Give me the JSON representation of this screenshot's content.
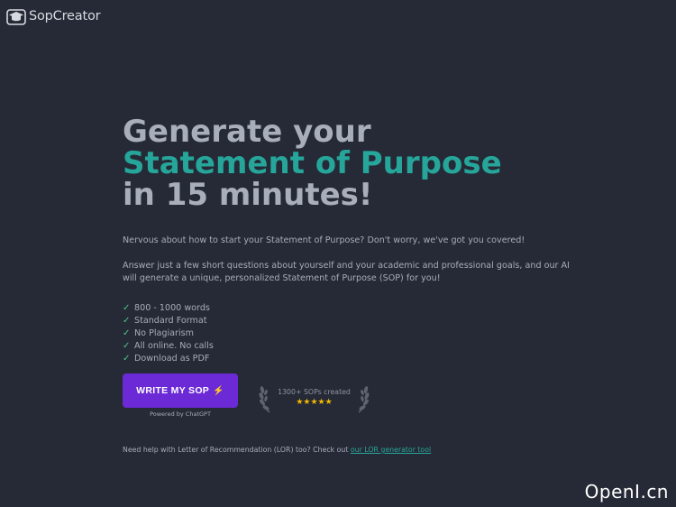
{
  "header": {
    "brand": "SopCreator",
    "logo_icon": "graduation-cap-box-icon"
  },
  "hero": {
    "line1": "Generate your",
    "line2": "Statement of Purpose",
    "line3": "in 15 minutes!",
    "accent_color": "#26a69a"
  },
  "intro": {
    "p1": "Nervous about how to start your Statement of Purpose? Don't worry, we've got you covered!",
    "p2": "Answer just a few short questions about yourself and your academic and professional goals, and our AI will generate a unique, personalized Statement of Purpose (SOP) for you!"
  },
  "features": [
    "800 - 1000 words",
    "Standard Format",
    "No Plagiarism",
    "All online. No calls",
    "Download as PDF"
  ],
  "cta": {
    "label": "WRITE MY SOP",
    "icon": "lightning-icon",
    "powered": "Powered by ChatGPT",
    "color": "#6b2ad6"
  },
  "badge": {
    "text": "1300+ SOPs created",
    "stars": "★★★★★",
    "rating": 5
  },
  "footer": {
    "text": "Need help with Letter of Recommendation (LOR) too? Check out",
    "link": "our LOR generator tool"
  },
  "watermark": "OpenI.cn"
}
